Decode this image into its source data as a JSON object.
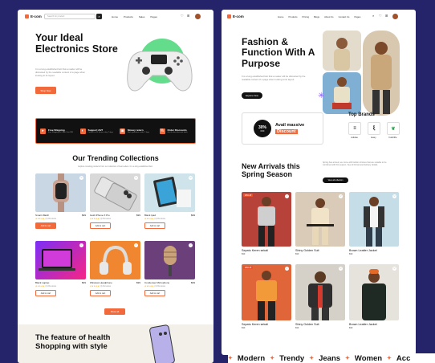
{
  "common": {
    "logo": "E-com",
    "search_placeholder": "Search for product",
    "search_icon": "search-icon",
    "menu_left": [
      "Home",
      "Products",
      "Sales",
      "Pages"
    ],
    "menu_right": [
      "Home",
      "Products",
      "Pricing",
      "Blogs",
      "About Us",
      "Contact Us",
      "Pages"
    ]
  },
  "left": {
    "hero": {
      "title": "Your Ideal Electronics Store",
      "desc": "It is a long established fact that a reader will be distracted by the readable content of a page when looking at its layout.",
      "cta": "Shop Now"
    },
    "features": [
      {
        "title": "Free Shipping",
        "sub": "Free Shipping for Order Over $99",
        "icon": "truck-icon"
      },
      {
        "title": "Support 24/7",
        "sub": "Contact us 24 hours a day, 7 days",
        "icon": "headset-icon"
      },
      {
        "title": "Money return",
        "sub": "Back guarantee under 7 days",
        "icon": "wallet-icon"
      },
      {
        "title": "Order Discounts",
        "sub": "Get the best discount deals",
        "icon": "discount-icon"
      }
    ],
    "trending": {
      "title": "Our Trending Collections",
      "desc": "Explore trending products from our collection of best sellers. It is a long established fact."
    },
    "products": [
      {
        "name": "Smart Watch",
        "price": "$99",
        "rating": "★★★★★",
        "reviews": "(4) Reviews",
        "btn": "Add to cart"
      },
      {
        "name": "Gold iPhone X Pro",
        "price": "$99",
        "rating": "★★★★★",
        "reviews": "(4) Reviews",
        "btn": "Add to cart"
      },
      {
        "name": "Black Ipad",
        "price": "$99",
        "rating": "★★★★★",
        "reviews": "(4) Reviews",
        "btn": "Add to cart"
      },
      {
        "name": "Black Laptop",
        "price": "$99",
        "rating": "★★★★★",
        "reviews": "(4) Reviews",
        "btn": "Add to cart"
      },
      {
        "name": "Wireless Headphone",
        "price": "$99",
        "rating": "★★★★★",
        "reviews": "(4) Reviews",
        "btn": "Add to cart"
      },
      {
        "name": "Condenser Microphone",
        "price": "$99",
        "rating": "★★★★★",
        "reviews": "(4) Reviews",
        "btn": "Add to cart"
      }
    ],
    "show_all": "Show all",
    "feature_heading": "The feature of health Shopping with style"
  },
  "right": {
    "hero": {
      "title": "Fashion & Function With A Purpose",
      "desc": "It is a long established fact that a reader will be distracted by the readable content of a page when looking at its layout.",
      "cta": "Explore Now"
    },
    "promo": {
      "percent": "30%",
      "off": "OFF",
      "text": "Avail massive",
      "highlight": "Discount"
    },
    "brands": {
      "title": "Top Brands",
      "items": [
        "Adidas",
        "Easy",
        "Fabrilife"
      ]
    },
    "arrivals": {
      "title": "New Arrivals this Spring Season",
      "desc": "Spring has arrived, we come with fashion choices that are suitable to be combined with this season. See all format and delivery details.",
      "btn": "View all collection"
    },
    "products": [
      {
        "name": "Sepatu Keren sekali",
        "price": "$99",
        "badge": "20% off"
      },
      {
        "name": "Shiny Golden Suit",
        "price": "$99",
        "badge": ""
      },
      {
        "name": "Brown Leatter Jacket",
        "price": "$99",
        "badge": ""
      },
      {
        "name": "Sepatu Keren sekali",
        "price": "$99",
        "badge": "20% off"
      },
      {
        "name": "Shiny Golden Suit",
        "price": "$99",
        "badge": ""
      },
      {
        "name": "Brown Leatter Jacket",
        "price": "$99",
        "badge": ""
      }
    ],
    "marquee": [
      "Modern",
      "Trendy",
      "Jeans",
      "Women",
      "Acc"
    ]
  },
  "colors": {
    "accent": "#f26a3b",
    "dark": "#111111",
    "background": "#25246a"
  }
}
